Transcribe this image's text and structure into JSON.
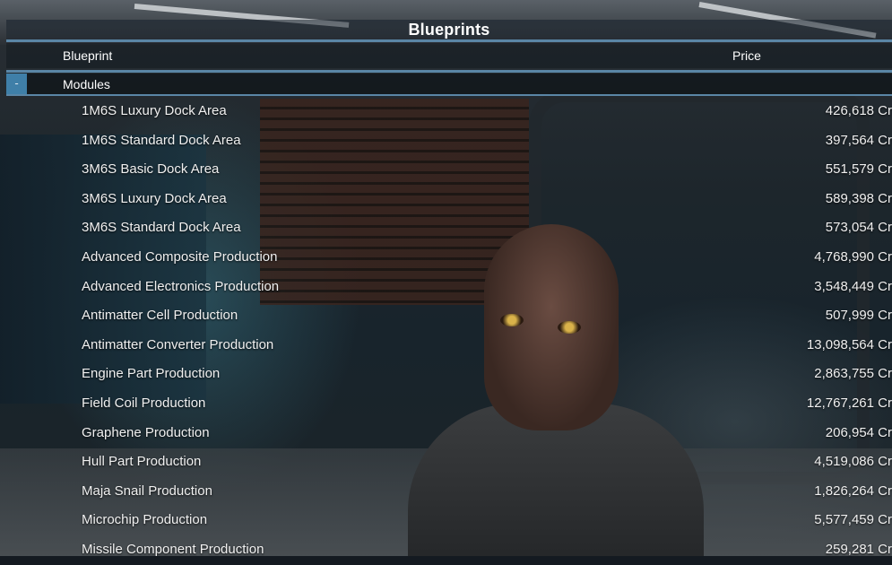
{
  "window": {
    "title": "Blueprints"
  },
  "columns": {
    "blueprint": "Blueprint",
    "price": "Price"
  },
  "group": {
    "collapse_symbol": "-",
    "label": "Modules"
  },
  "currency_suffix": "Cr",
  "blueprints": [
    {
      "name": "1M6S Luxury Dock Area",
      "price": "426,618 Cr"
    },
    {
      "name": "1M6S Standard Dock Area",
      "price": "397,564 Cr"
    },
    {
      "name": "3M6S Basic Dock Area",
      "price": "551,579 Cr"
    },
    {
      "name": "3M6S Luxury Dock Area",
      "price": "589,398 Cr"
    },
    {
      "name": "3M6S Standard Dock Area",
      "price": "573,054 Cr"
    },
    {
      "name": "Advanced Composite Production",
      "price": "4,768,990 Cr"
    },
    {
      "name": "Advanced Electronics Production",
      "price": "3,548,449 Cr"
    },
    {
      "name": "Antimatter Cell Production",
      "price": "507,999 Cr"
    },
    {
      "name": "Antimatter Converter Production",
      "price": "13,098,564 Cr"
    },
    {
      "name": "Engine Part Production",
      "price": "2,863,755 Cr"
    },
    {
      "name": "Field Coil Production",
      "price": "12,767,261 Cr"
    },
    {
      "name": "Graphene Production",
      "price": "206,954 Cr"
    },
    {
      "name": "Hull Part Production",
      "price": "4,519,086 Cr"
    },
    {
      "name": "Maja Snail Production",
      "price": "1,826,264 Cr"
    },
    {
      "name": "Microchip Production",
      "price": "5,577,459 Cr"
    },
    {
      "name": "Missile Component Production",
      "price": "259,281 Cr"
    }
  ],
  "colors": {
    "accent": "#5a86a6",
    "collapse_button": "#3f7fa8",
    "text": "#f0f0f0"
  }
}
